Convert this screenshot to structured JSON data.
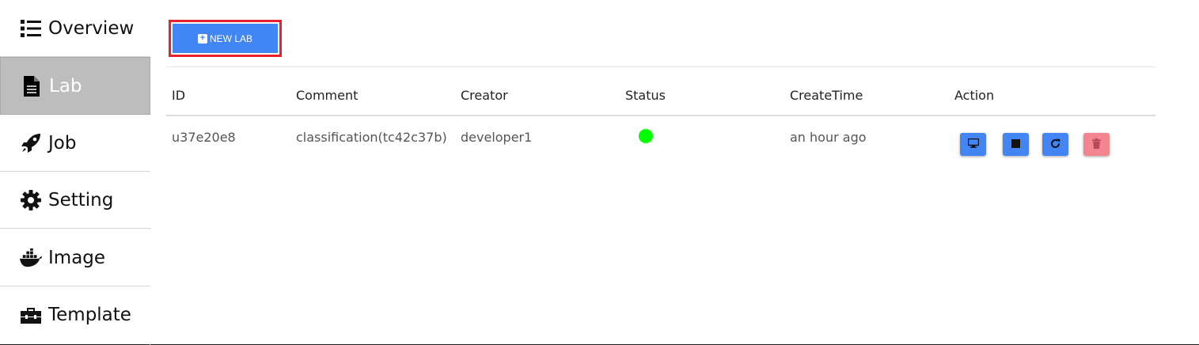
{
  "sidebar": {
    "items": [
      {
        "label": "Overview",
        "icon": "list-icon",
        "active": false
      },
      {
        "label": "Lab",
        "icon": "file-icon",
        "active": true
      },
      {
        "label": "Job",
        "icon": "rocket-icon",
        "active": false
      },
      {
        "label": "Setting",
        "icon": "gear-icon",
        "active": false
      },
      {
        "label": "Image",
        "icon": "docker-icon",
        "active": false
      },
      {
        "label": "Template",
        "icon": "toolbox-icon",
        "active": false
      }
    ]
  },
  "toolbar": {
    "new_lab_label": "NEW LAB"
  },
  "table": {
    "headers": [
      "ID",
      "Comment",
      "Creator",
      "Status",
      "CreateTime",
      "Action"
    ],
    "rows": [
      {
        "id": "u37e20e8",
        "comment": "classification(tc42c37b)",
        "creator": "developer1",
        "status": "running",
        "create_time": "an hour ago"
      }
    ],
    "actions": [
      "desktop-icon",
      "stop-icon",
      "restart-icon",
      "trash-icon"
    ]
  },
  "colors": {
    "primary": "#4285f4",
    "danger": "#f48590",
    "status_running": "#00ff00",
    "active_nav": "#bdbdbd",
    "highlight": "#e8222c"
  }
}
